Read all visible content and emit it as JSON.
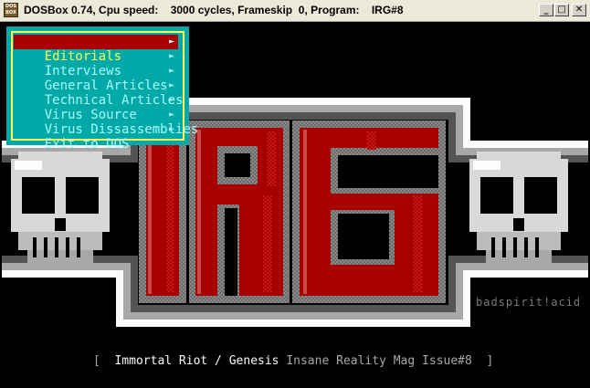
{
  "window": {
    "icon_text": "DOS BOX",
    "title": "DOSBox 0.74, Cpu speed:    3000 cycles, Frameskip  0, Program:    IRG#8",
    "minimize": "_",
    "maximize": "□",
    "close": "✕"
  },
  "menu": {
    "items": [
      {
        "label": "Editorials",
        "selected": true
      },
      {
        "label": "Interviews",
        "selected": false
      },
      {
        "label": "General Articles",
        "selected": false
      },
      {
        "label": "Technical Articles",
        "selected": false
      },
      {
        "label": "Virus Source",
        "selected": false
      },
      {
        "label": "Virus Dissassemblies",
        "selected": false
      },
      {
        "label": "Exit to DOS",
        "selected": false
      }
    ],
    "arrow_icon": "triangle-right-icon",
    "arrow_glyph": "►"
  },
  "logo": {
    "letters": [
      "I",
      "R",
      "G"
    ],
    "credit": "badspirit!acid"
  },
  "footer": {
    "bracket_open": "[",
    "group": "Immortal Riot / Genesis",
    "mag": "Insane Reality Mag Issue#8",
    "bracket_close": "]"
  },
  "colors": {
    "menu_bg": "#00a8a8",
    "menu_border": "#fefe54",
    "selected_bg": "#a80000",
    "logo_red": "#a80000",
    "logo_gray": "#a8a8a8"
  }
}
